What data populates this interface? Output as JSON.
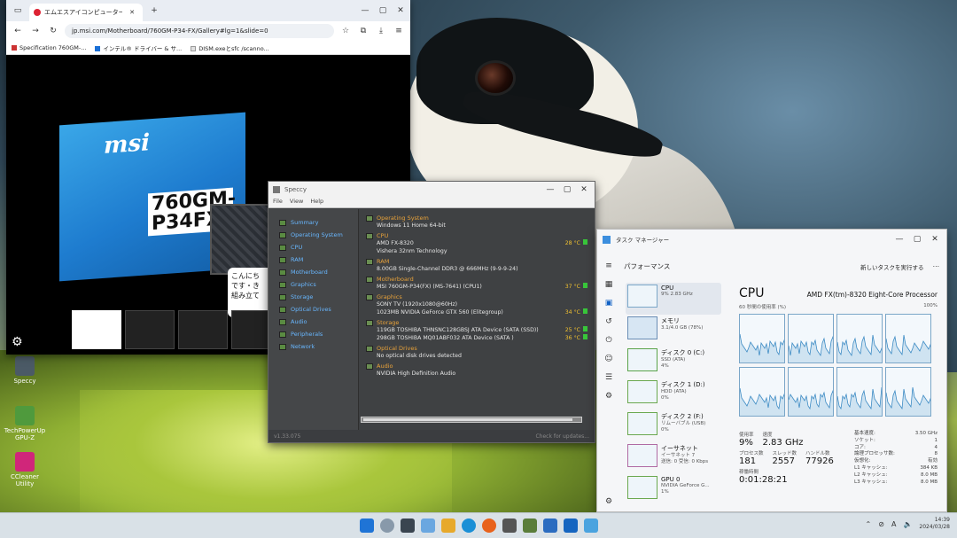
{
  "browser": {
    "tab_title": "エムエスアイコンピュータージャパン | T...",
    "url": "jp.msi.com/Motherboard/760GM-P34-FX/Gallery#lg=1&slide=0",
    "bookmarks": [
      "Specification 760GM-...",
      "インテル® ドライバー & サ...",
      "DISM.exeとsfc /scanno..."
    ],
    "box_brand": "msi",
    "box_model": "760GM-P34FX",
    "tooltip": "こんにち\nです・き\n組み立て"
  },
  "desktop_icons": [
    "Speccy",
    "TechPowerUp GPU-Z",
    "CCleaner Utility"
  ],
  "speccy": {
    "title": "Speccy",
    "menu": [
      "File",
      "View",
      "Help"
    ],
    "nav": [
      "Summary",
      "Operating System",
      "CPU",
      "RAM",
      "Motherboard",
      "Graphics",
      "Storage",
      "Optical Drives",
      "Audio",
      "Peripherals",
      "Network"
    ],
    "sections": [
      {
        "head": "Operating System",
        "lines": [
          {
            "t": "Windows 11 Home 64-bit",
            "temp": ""
          }
        ]
      },
      {
        "head": "CPU",
        "lines": [
          {
            "t": "AMD FX-8320",
            "temp": "28 °C"
          },
          {
            "t": "Vishera 32nm Technology",
            "temp": ""
          }
        ]
      },
      {
        "head": "RAM",
        "lines": [
          {
            "t": "8.00GB Single-Channel DDR3 @ 666MHz (9-9-9-24)",
            "temp": ""
          }
        ]
      },
      {
        "head": "Motherboard",
        "lines": [
          {
            "t": "MSI 760GM-P34(FX) (MS-7641) (CPU1)",
            "temp": "37 °C"
          }
        ]
      },
      {
        "head": "Graphics",
        "lines": [
          {
            "t": "SONY TV (1920x1080@60Hz)",
            "temp": ""
          },
          {
            "t": "1023MB NVIDIA GeForce GTX 560 (Elitegroup)",
            "temp": "34 °C"
          }
        ]
      },
      {
        "head": "Storage",
        "lines": [
          {
            "t": "119GB TOSHIBA THNSNC128GBSJ ATA Device (SATA (SSD))",
            "temp": "25 °C"
          },
          {
            "t": "298GB TOSHIBA MQ01ABF032 ATA Device (SATA )",
            "temp": "36 °C"
          }
        ]
      },
      {
        "head": "Optical Drives",
        "lines": [
          {
            "t": "No optical disk drives detected",
            "temp": ""
          }
        ]
      },
      {
        "head": "Audio",
        "lines": [
          {
            "t": "NVIDIA High Definition Audio",
            "temp": ""
          }
        ]
      }
    ],
    "version": "v1.33.075",
    "update": "Check for updates..."
  },
  "taskmgr": {
    "title": "タスク マネージャー",
    "section": "パフォーマンス",
    "new_task": "新しいタスクを実行する",
    "items": [
      {
        "name": "CPU",
        "sub": "9% 2.83 GHz"
      },
      {
        "name": "メモリ",
        "sub": "3.1/4.0 GB (78%)"
      },
      {
        "name": "ディスク 0 (C:)",
        "sub": "SSD (ATA)\n4%"
      },
      {
        "name": "ディスク 1 (D:)",
        "sub": "HDD (ATA)\n0%"
      },
      {
        "name": "ディスク 2 (F:)",
        "sub": "リムーバブル (USB)\n0%"
      },
      {
        "name": "イーサネット",
        "sub": "イーサネット 7\n送信: 0 受信: 0 Kbps"
      },
      {
        "name": "GPU 0",
        "sub": "NVIDIA GeForce G...\n1%"
      }
    ],
    "cpu_title": "CPU",
    "cpu_model": "AMD FX(tm)-8320 Eight-Core Processor",
    "graph_label": "60 秒間の使用率 (%)",
    "graph_max": "100%",
    "stats": {
      "usage_label": "使用率",
      "usage": "9%",
      "speed_label": "速度",
      "speed": "2.83 GHz",
      "proc_label": "プロセス数",
      "proc": "181",
      "threads_label": "スレッド数",
      "threads": "2557",
      "handles_label": "ハンドル数",
      "handles": "77926",
      "uptime_label": "稼働時間",
      "uptime": "0:01:28:21"
    },
    "details": [
      [
        "基本速度:",
        "3.50 GHz"
      ],
      [
        "ソケット:",
        "1"
      ],
      [
        "コア:",
        "4"
      ],
      [
        "論理プロセッサ数:",
        "8"
      ],
      [
        "仮想化:",
        "有効"
      ],
      [
        "L1 キャッシュ:",
        "384 KB"
      ],
      [
        "L2 キャッシュ:",
        "8.0 MB"
      ],
      [
        "L3 キャッシュ:",
        "8.0 MB"
      ]
    ]
  },
  "taskbar": {
    "time": "14:39",
    "date": "2024/03/28"
  }
}
